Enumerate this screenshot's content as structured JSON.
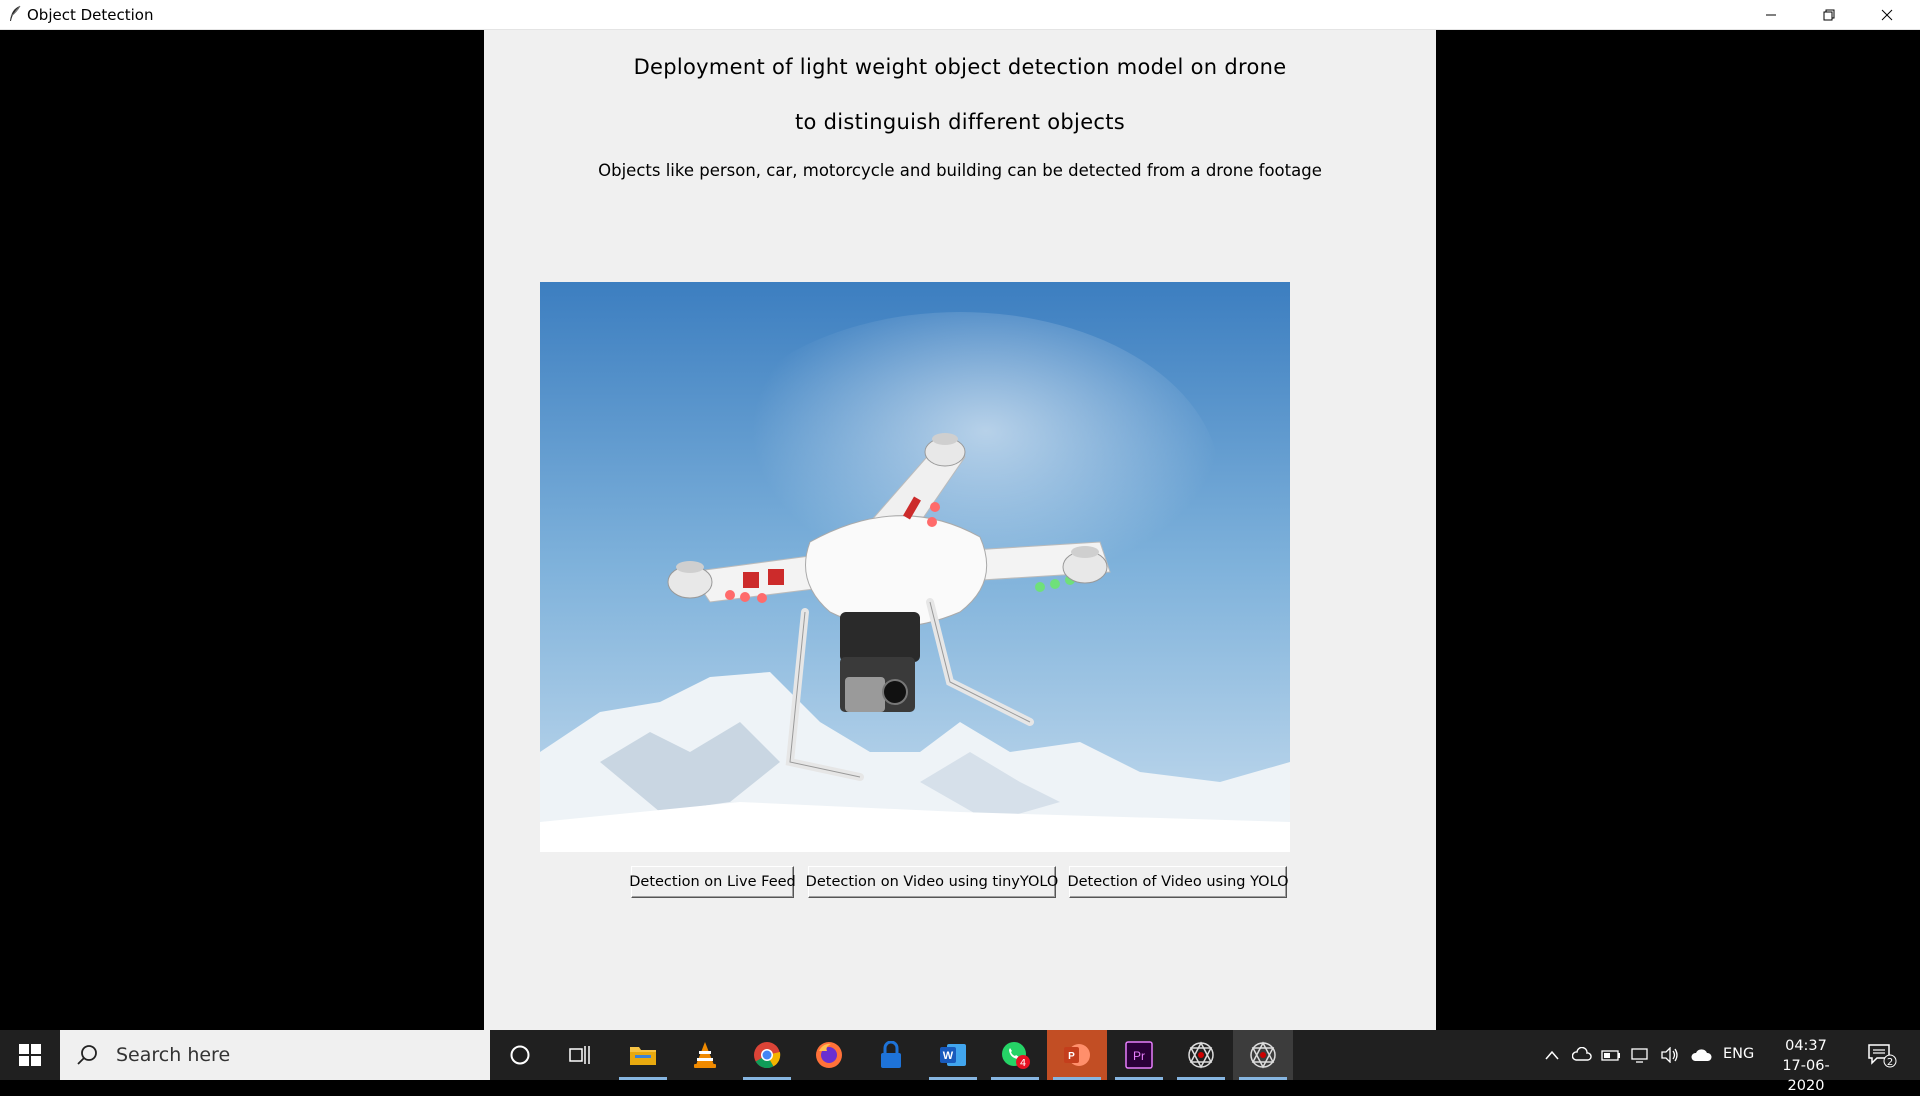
{
  "window": {
    "title": "Object Detection"
  },
  "app": {
    "heading_line1": "Deployment of light weight object detection model on drone",
    "heading_line2": "to distinguish different objects",
    "subheading": "Objects like person, car, motorcycle and building can be detected from a drone footage",
    "image_subject": "drone-photo",
    "buttons": {
      "live_feed": "Detection on Live Feed",
      "tiny_yolo": "Detection on Video using tinyYOLO",
      "yolo": "Detection of Video using YOLO"
    }
  },
  "taskbar": {
    "search_placeholder": "Search here",
    "apps": [
      "cortana-icon",
      "task-view-icon",
      "file-explorer-icon",
      "vlc-icon",
      "chrome-icon",
      "firefox-icon",
      "lock-app-icon",
      "word-icon",
      "whatsapp-icon",
      "powerpoint-icon",
      "premiere-icon",
      "spider-app-icon",
      "spider-app-icon-active"
    ],
    "whatsapp_badge": "4",
    "language": "ENG",
    "time": "04:37",
    "date": "17-06-2020",
    "notifications_count": "2"
  },
  "colors": {
    "panel": "#f0f0f0",
    "taskbar": "#202020",
    "accent_underline": "#86b5e0",
    "powerpoint": "#c24e24"
  }
}
